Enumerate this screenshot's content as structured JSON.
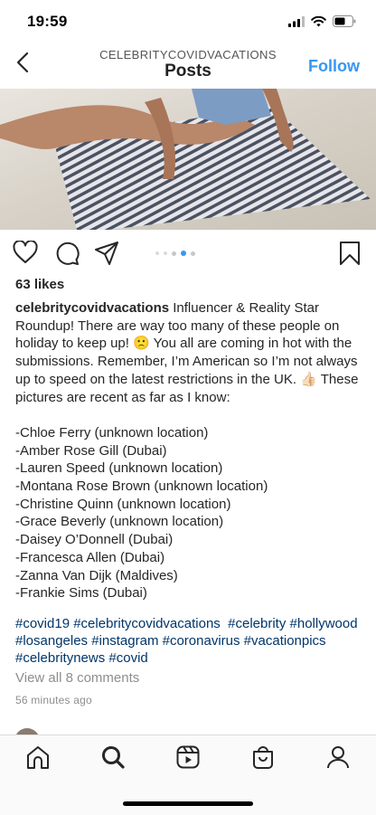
{
  "status_bar": {
    "time": "19:59",
    "icons": [
      "signal-icon",
      "wifi-icon",
      "battery-icon"
    ]
  },
  "header": {
    "username": "CELEBRITYCOVIDVACATIONS",
    "title": "Posts",
    "follow_label": "Follow",
    "back_icon": "chevron-left-icon"
  },
  "post": {
    "image_description": "photo",
    "carousel": {
      "count": 5,
      "active_index": 3
    },
    "likes": "63 likes",
    "caption": {
      "username": "celebritycovidvacations",
      "intro": " Influencer & Reality Star Roundup! There are way too many of these people on holiday to keep up! 🙁 You all are coming in hot with the submissions. Remember, I’m American so I’m not always up to speed on the latest restrictions in the UK. 👍🏻 These pictures are recent as far as I know:",
      "list": [
        "-Chloe Ferry (unknown location)",
        "-Amber Rose Gill (Dubai)",
        "-Lauren Speed (unknown location)",
        "-Montana Rose Brown (unknown location)",
        "-Christine Quinn (unknown location)",
        "-Grace Beverly (unknown location)",
        "-Daisey O’Donnell (Dubai)",
        "-Francesca Allen (Dubai)",
        "-Zanna Van Dijk (Maldives)",
        "-Frankie Sims (Dubai)"
      ],
      "hashtags": [
        "#covid19",
        "#celebritycovidvacations",
        "#celebrity",
        "#hollywood",
        "#losangeles",
        "#instagram",
        "#coronavirus",
        "#vacationpics",
        "#celebritynews",
        "#covid"
      ]
    },
    "view_comments": "View all 8 comments",
    "timestamp": "56 minutes ago"
  },
  "tab_bar": {
    "tabs": [
      "home-icon",
      "search-icon",
      "reels-icon",
      "shop-icon",
      "profile-icon"
    ]
  },
  "colors": {
    "accent": "#3897f0",
    "hashtag": "#003569",
    "muted": "#8e8e8e",
    "text": "#262626"
  }
}
